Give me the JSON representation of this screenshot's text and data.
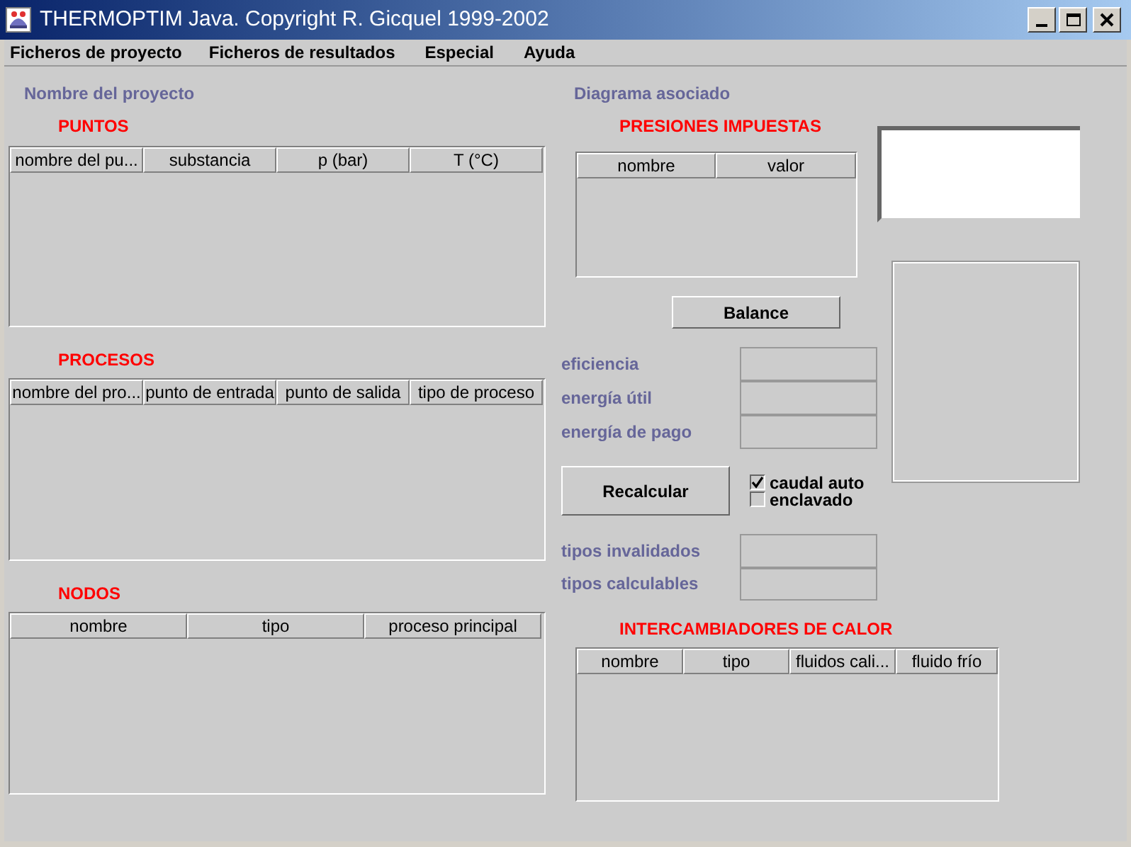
{
  "window": {
    "title": "THERMOPTIM Java. Copyright R. Gicquel 1999-2002"
  },
  "menu": [
    "Ficheros de proyecto",
    "Ficheros de resultados",
    "Especial",
    "Ayuda"
  ],
  "project_label": "Nombre del proyecto",
  "left_tables": [
    {
      "title": "PUNTOS",
      "columns": [
        "nombre del pu...",
        "substancia",
        "p (bar)",
        "T (°C)"
      ]
    },
    {
      "title": "PROCESOS",
      "columns": [
        "nombre del pro...",
        "punto de entrada",
        "punto de salida",
        "tipo de proceso"
      ]
    },
    {
      "title": "NODOS",
      "columns": [
        "nombre",
        "tipo",
        "proceso principal"
      ]
    }
  ],
  "diagram_label": "Diagrama asociado",
  "pressures": {
    "title": "PRESIONES IMPUESTAS",
    "columns": [
      "nombre",
      "valor"
    ]
  },
  "balance_button": "Balance",
  "results": [
    {
      "label": "eficiencia"
    },
    {
      "label": "energía útil"
    },
    {
      "label": "energía de pago"
    }
  ],
  "recalc_button": "Recalcular",
  "checkboxes": [
    {
      "label": "caudal auto",
      "checked": true
    },
    {
      "label": "enclavado",
      "checked": false
    }
  ],
  "types": [
    {
      "label": "tipos invalidados"
    },
    {
      "label": "tipos calculables"
    }
  ],
  "exchangers": {
    "title": "INTERCAMBIADORES DE CALOR",
    "columns": [
      "nombre",
      "tipo",
      "fluidos cali...",
      "fluido frío"
    ]
  }
}
